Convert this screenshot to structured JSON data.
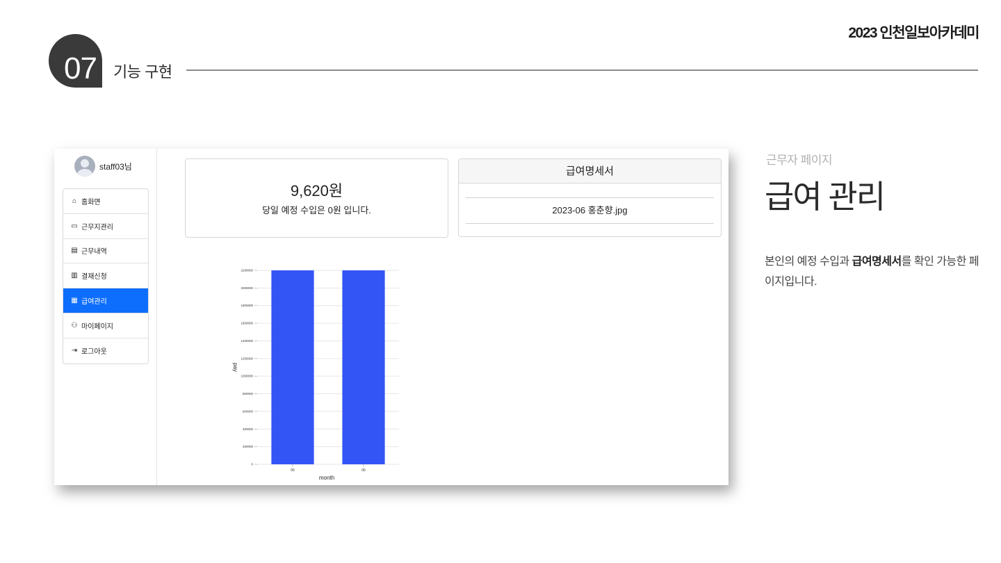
{
  "slide": {
    "brand": "2023 인천일보아카데미",
    "section_number": "07",
    "section_title": "기능 구현"
  },
  "app": {
    "user": {
      "name": "staff03님"
    },
    "menu": [
      {
        "label": "홈화면",
        "icon": "home-icon",
        "active": false
      },
      {
        "label": "근무지관리",
        "icon": "briefcase-icon",
        "active": false
      },
      {
        "label": "근무내역",
        "icon": "calendar-icon",
        "active": false
      },
      {
        "label": "결재신청",
        "icon": "approval-icon",
        "active": false
      },
      {
        "label": "급여관리",
        "icon": "calculator-icon",
        "active": true
      },
      {
        "label": "마이페이지",
        "icon": "people-icon",
        "active": false
      },
      {
        "label": "로그아웃",
        "icon": "logout-icon",
        "active": false
      }
    ],
    "income": {
      "amount": "9,620원",
      "note": "당일 예정 수입은 0원 입니다."
    },
    "payslip": {
      "header": "급여명세서",
      "files": [
        "2023-06 홍춘향.jpg"
      ]
    }
  },
  "chart_data": {
    "type": "bar",
    "categories": [
      "05",
      "06"
    ],
    "values": [
      2200000,
      2200000
    ],
    "xlabel": "month",
    "ylabel": "pay",
    "ylim": [
      0,
      2200000
    ],
    "yticks": [
      0,
      200000,
      400000,
      600000,
      800000,
      1000000,
      1200000,
      1400000,
      1600000,
      1800000,
      2000000,
      2200000
    ],
    "color": "#3355f6",
    "grid": true
  },
  "description": {
    "subtitle": "근무자 페이지",
    "title": "급여 관리",
    "text_before": "본인의 예정 수입과 ",
    "text_bold": "급여명세서",
    "text_after": "를 확인 가능한 페이지입니다."
  },
  "colors": {
    "accent": "#0d6efd",
    "bar": "#3355f6",
    "badge": "#3a3a3a"
  }
}
